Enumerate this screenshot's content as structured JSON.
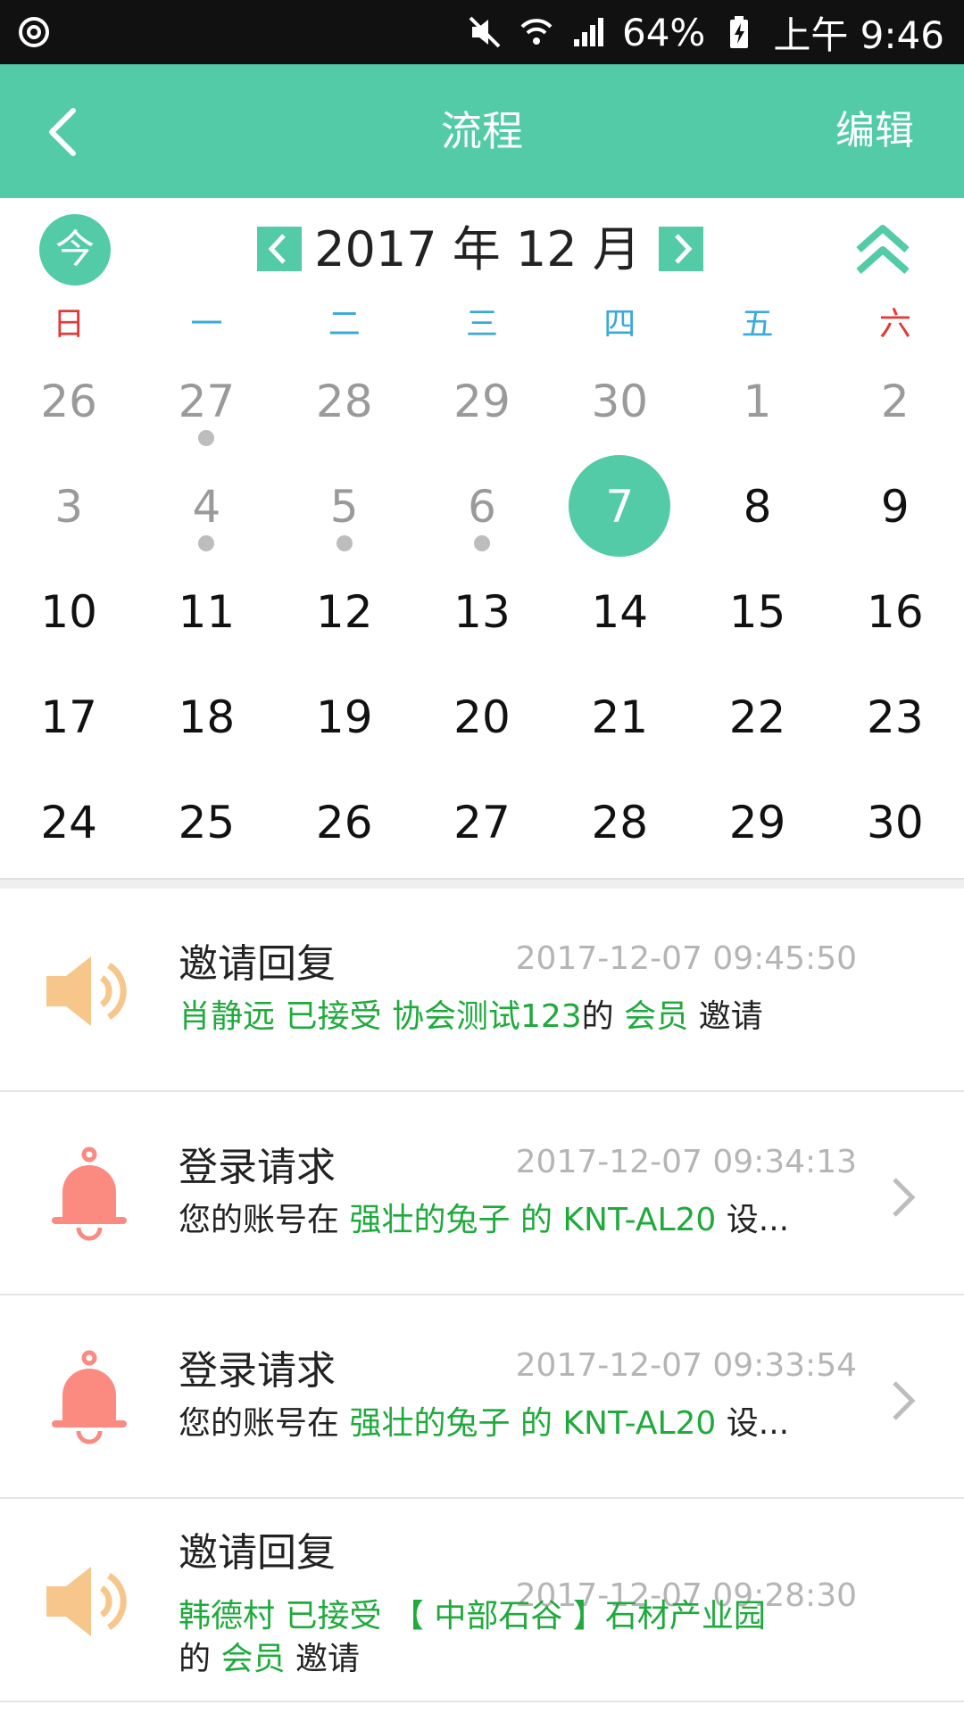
{
  "status_bar": {
    "battery": "64%",
    "time": "上午 9:46"
  },
  "app_bar": {
    "title": "流程",
    "edit_label": "编辑"
  },
  "calendar": {
    "today_label": "今",
    "month_title": "2017 年 12 月",
    "weekdays": [
      "日",
      "一",
      "二",
      "三",
      "四",
      "五",
      "六"
    ],
    "weeks": [
      [
        "26",
        "27",
        "28",
        "29",
        "30",
        "1",
        "2"
      ],
      [
        "3",
        "4",
        "5",
        "6",
        "7",
        "8",
        "9"
      ],
      [
        "10",
        "11",
        "12",
        "13",
        "14",
        "15",
        "16"
      ],
      [
        "17",
        "18",
        "19",
        "20",
        "21",
        "22",
        "23"
      ],
      [
        "24",
        "25",
        "26",
        "27",
        "28",
        "29",
        "30"
      ]
    ],
    "selected_day": "7"
  },
  "notifications": [
    {
      "type": "invite",
      "title": "邀请回复",
      "time": "2017-12-07 09:45:50",
      "name": "肖静远",
      "action": "已接受",
      "org": "协会测试123",
      "of": "的",
      "role": "会员",
      "tail": "邀请"
    },
    {
      "type": "login",
      "title": "登录请求",
      "time": "2017-12-07 09:34:13",
      "prefix": "您的账号在",
      "device_owner": "强壮的兔子",
      "of": "的",
      "device": "KNT-AL20",
      "suffix": "设..."
    },
    {
      "type": "login",
      "title": "登录请求",
      "time": "2017-12-07 09:33:54",
      "prefix": "您的账号在",
      "device_owner": "强壮的兔子",
      "of": "的",
      "device": "KNT-AL20",
      "suffix": "设..."
    },
    {
      "type": "invite",
      "title": "邀请回复",
      "time": "2017-12-07 09:28:30",
      "name": "韩德村",
      "action": "已接受",
      "org": "【 中部石谷 】石材产业园",
      "of": "的",
      "role": "会员",
      "tail": "邀请"
    }
  ],
  "colors": {
    "accent": "#52cba6",
    "highlight_text": "#1faa3c",
    "weekday": "#3aa9dc",
    "weekend": "#e53935",
    "invite_icon": "#f7c68a",
    "login_icon": "#fb8a80"
  }
}
